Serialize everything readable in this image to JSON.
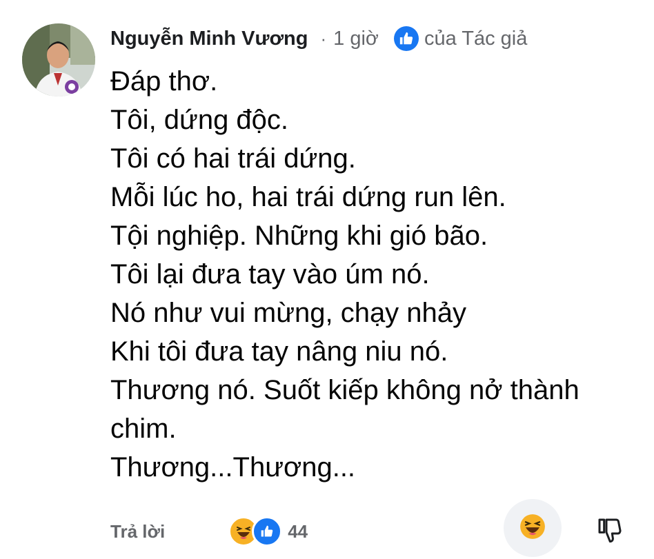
{
  "comment": {
    "author": "Nguyễn Minh Vương",
    "separator": "·",
    "time": "1 giờ",
    "author_liked_label": "của Tác giả",
    "lines": [
      "Đáp thơ.",
      "Tôi, dứng độc.",
      "Tôi có hai trái dứng.",
      "Mỗi lúc ho, hai trái dứng run lên.",
      "Tội nghiệp. Những khi gió bão.",
      "Tôi lại đưa tay vào úm nó.",
      "Nó như vui mừng, chạy nhảy",
      "Khi tôi đưa tay nâng niu nó.",
      "Thương nó. Suốt kiếp không nở thành",
      "chim.",
      "Thương...Thương..."
    ]
  },
  "footer": {
    "reply_label": "Trả lời",
    "reaction_count": "44",
    "reaction_icons": [
      "haha-icon",
      "like-icon"
    ]
  },
  "colors": {
    "like_blue": "#1877f2",
    "haha_yellow": "#f7b125",
    "secondary_text": "#65676b",
    "reaction_button_bg": "#f0f2f5"
  }
}
